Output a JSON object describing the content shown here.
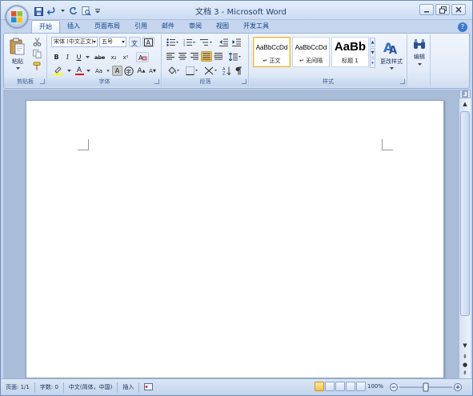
{
  "window": {
    "title": "文档 3 - Microsoft Word"
  },
  "quick_access": {
    "items": [
      "save-icon",
      "undo-icon",
      "redo-icon",
      "print-preview-icon",
      "customize-icon"
    ]
  },
  "tabs": [
    {
      "label": "开始",
      "active": true
    },
    {
      "label": "插入"
    },
    {
      "label": "页面布局"
    },
    {
      "label": "引用"
    },
    {
      "label": "邮件"
    },
    {
      "label": "审阅"
    },
    {
      "label": "视图"
    },
    {
      "label": "开发工具"
    }
  ],
  "clipboard": {
    "paste_label": "粘贴",
    "group_label": "剪贴板"
  },
  "font": {
    "font_name": "宋体 (中文正文)",
    "font_size": "五号",
    "bold": "B",
    "italic": "I",
    "underline": "U",
    "strikethrough": "abe",
    "subscript": "x₂",
    "superscript": "x²",
    "font_color": "A",
    "change_case": "Aa",
    "char_shading": "A",
    "enclose": "字",
    "grow": "A",
    "shrink": "A",
    "group_label": "字体"
  },
  "paragraph": {
    "group_label": "段落"
  },
  "styles": {
    "items": [
      {
        "preview": "AaBbCcDd",
        "name": "正文",
        "selected": true
      },
      {
        "preview": "AaBbCcDd",
        "name": "无间隔"
      },
      {
        "preview": "AaBb",
        "name": "标题 1",
        "big": true
      }
    ],
    "change_styles_label": "更改样式",
    "group_label": "样式"
  },
  "editing": {
    "label": "编辑"
  },
  "statusbar": {
    "page": "页面: 1/1",
    "words": "字数: 0",
    "language": "中文(简体，中国)",
    "insert_mode": "插入",
    "zoom": "100%"
  },
  "colors": {
    "accent": "#15428b",
    "ribbon_bg": "#e2ebf8",
    "highlight": "#f7c14e"
  }
}
